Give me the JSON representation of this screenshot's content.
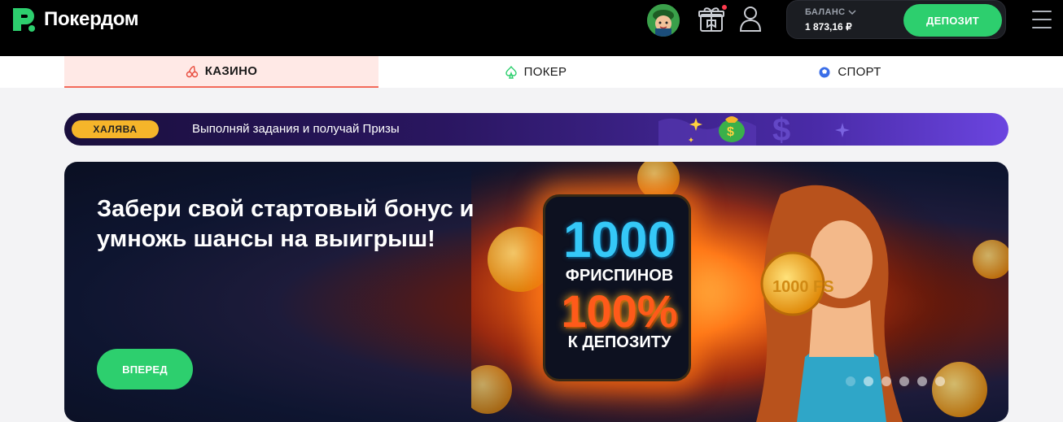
{
  "brand": {
    "name": "Покердом"
  },
  "header": {
    "balance_label": "БАЛАНС",
    "balance_value": "1 873,16 ₽",
    "deposit_label": "ДЕПОЗИТ"
  },
  "tabs": [
    {
      "label": "КАЗИНО",
      "icon": "cherries-icon",
      "active": true
    },
    {
      "label": "ПОКЕР",
      "icon": "spade-icon",
      "active": false
    },
    {
      "label": "СПОРТ",
      "icon": "ball-icon",
      "active": false
    }
  ],
  "promo": {
    "badge": "ХАЛЯВА",
    "text": "Выполняй задания и получай Призы"
  },
  "banner": {
    "title": "Забери свой стартовый бонус и умножь шансы на выигрыш!",
    "button_label": "ВПЕРЕД",
    "freespins_number": "1000",
    "freespins_label": "ФРИСПИНОВ",
    "deposit_percent": "100%",
    "deposit_label": "К ДЕПОЗИТУ",
    "coin_text": "1000 FS",
    "slides_count": 6
  },
  "colors": {
    "accent_green": "#2dcf6e",
    "header_bg": "#000000",
    "active_tab_bg": "#ffe9e6",
    "freebie_badge": "#f5b52a"
  }
}
